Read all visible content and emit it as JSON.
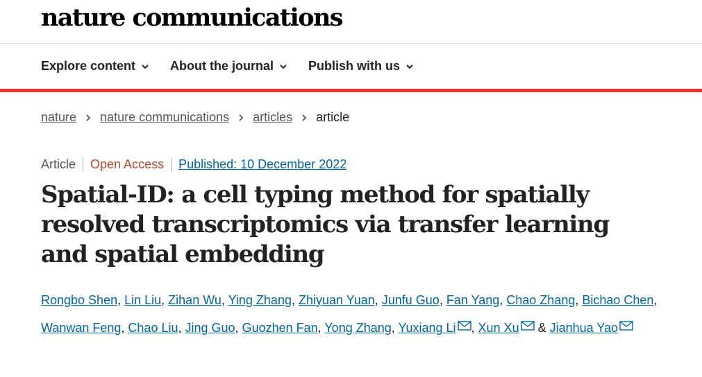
{
  "brand": "nature communications",
  "nav": [
    {
      "label": "Explore content"
    },
    {
      "label": "About the journal"
    },
    {
      "label": "Publish with us"
    }
  ],
  "breadcrumb": {
    "items": [
      "nature",
      "nature communications",
      "articles"
    ],
    "current": "article"
  },
  "meta": {
    "type": "Article",
    "access": "Open Access",
    "published": "Published: 10 December 2022"
  },
  "title": "Spatial-ID: a cell typing method for spatially resolved transcriptomics via transfer learning and spatial embedding",
  "authors": [
    "Rongbo Shen",
    "Lin Liu",
    "Zihan Wu",
    "Ying Zhang",
    "Zhiyuan Yuan",
    "Junfu Guo",
    "Fan Yang",
    "Chao Zhang",
    "Bichao Chen",
    "Wanwan Feng",
    "Chao Liu",
    "Jing Guo",
    "Guozhen Fan",
    "Yong Zhang",
    "Yuxiang Li",
    "Xun Xu",
    "Jianhua Yao"
  ],
  "author_separator": ", ",
  "author_conjunction": "&",
  "corresponding_authors": [
    "Yuxiang Li",
    "Xun Xu",
    "Jianhua Yao"
  ],
  "colors": {
    "accent": "#e5322d",
    "link": "#00659e",
    "open_access": "#b9482c"
  }
}
